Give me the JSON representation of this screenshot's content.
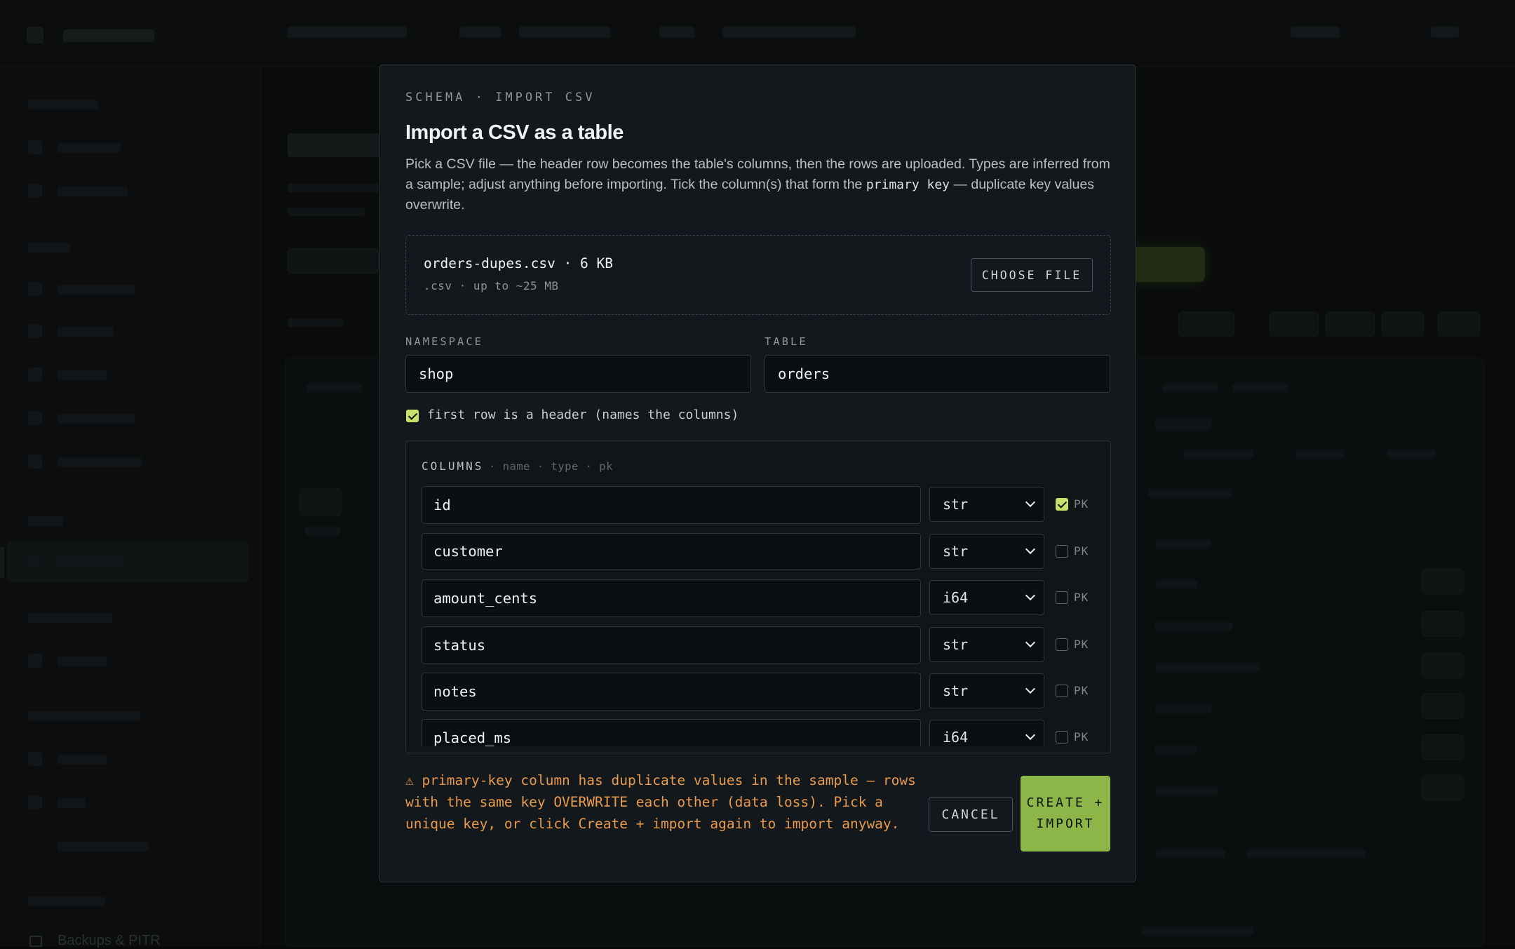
{
  "modal": {
    "eyebrow": "SCHEMA · IMPORT CSV",
    "title": "Import a CSV as a table",
    "description_part1": "Pick a CSV file — the header row becomes the table's columns, then the rows are uploaded. Types are inferred from a sample; adjust anything before importing. Tick the column(s) that form the ",
    "description_code": "primary key",
    "description_part2": " — duplicate key values overwrite.",
    "file": {
      "name": "orders-dupes.csv · 6 KB",
      "hint": ".csv · up to ~25 MB",
      "choose_label": "CHOOSE FILE"
    },
    "namespace": {
      "label": "NAMESPACE",
      "value": "shop"
    },
    "table": {
      "label": "TABLE",
      "value": "orders"
    },
    "header_option": {
      "label": "first row is a header (names the columns)",
      "checked": true
    },
    "columns": {
      "heading": "COLUMNS",
      "subheading": "· name · type · pk",
      "pk_label": "PK",
      "rows": [
        {
          "name": "id",
          "type": "str",
          "pk": true
        },
        {
          "name": "customer",
          "type": "str",
          "pk": false
        },
        {
          "name": "amount_cents",
          "type": "i64",
          "pk": false
        },
        {
          "name": "status",
          "type": "str",
          "pk": false
        },
        {
          "name": "notes",
          "type": "str",
          "pk": false
        },
        {
          "name": "placed_ms",
          "type": "i64",
          "pk": false
        }
      ]
    },
    "warning": "⚠ primary-key column has duplicate values in the sample — rows with the same key OVERWRITE each other (data loss). Pick a unique key, or click Create + import again to import anyway.",
    "cancel_label": "CANCEL",
    "create_label": "CREATE + IMPORT"
  },
  "background": {
    "backups_label": "Backups & PITR"
  },
  "colors": {
    "accent": "#8cb648",
    "checkbox_on": "#c6e26a",
    "warning": "#e99a4c",
    "modal_bg": "#12181b"
  }
}
